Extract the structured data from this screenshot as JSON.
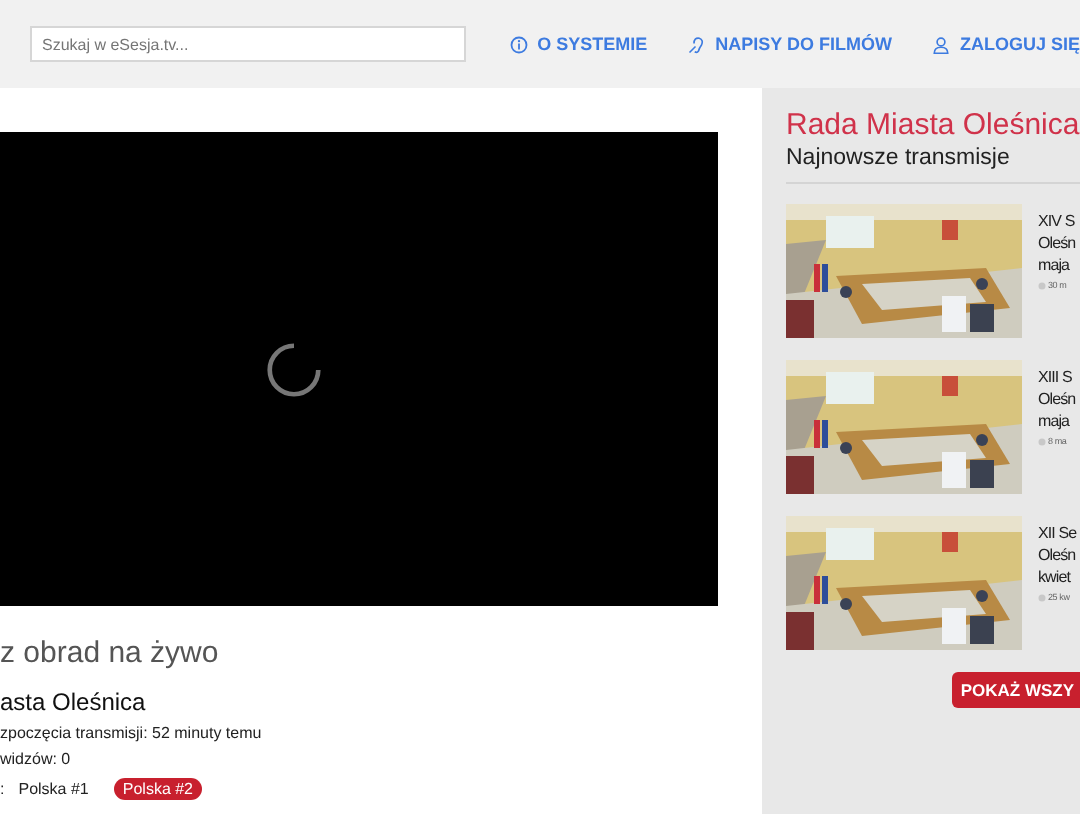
{
  "header": {
    "search": {
      "placeholder": "Szukaj w eSesja.tv..."
    },
    "nav": [
      {
        "label": "O SYSTEMIE"
      },
      {
        "label": "NAPISY DO FILMÓW"
      },
      {
        "label": "ZALOGUJ SIĘ"
      }
    ]
  },
  "live": {
    "heading": "z obrad na żywo",
    "title": "asta Oleśnica",
    "info": [
      "zpoczęcia transmisji: 52 minuty temu",
      "widzów: 0"
    ],
    "streams_label": ":",
    "streams": [
      {
        "label": "Polska #1",
        "selected": false
      },
      {
        "label": "Polska #2",
        "selected": true
      }
    ]
  },
  "sidebar": {
    "title": "Rada Miasta Oleśnica",
    "subtitle": "Najnowsze transmisje",
    "items": [
      {
        "lines": [
          "XIV S",
          "Oleśn",
          "maja"
        ],
        "date": "30 m",
        "kind": "picture"
      },
      {
        "lines": [
          "XIII S",
          "Oleśn",
          "maja"
        ],
        "date": "8 ma",
        "kind": "picture"
      },
      {
        "lines": [
          "XII Se",
          "Oleśn",
          "kwiet"
        ],
        "date": "25 kw",
        "kind": "picture"
      }
    ],
    "button": "POKAŻ WSZY"
  }
}
